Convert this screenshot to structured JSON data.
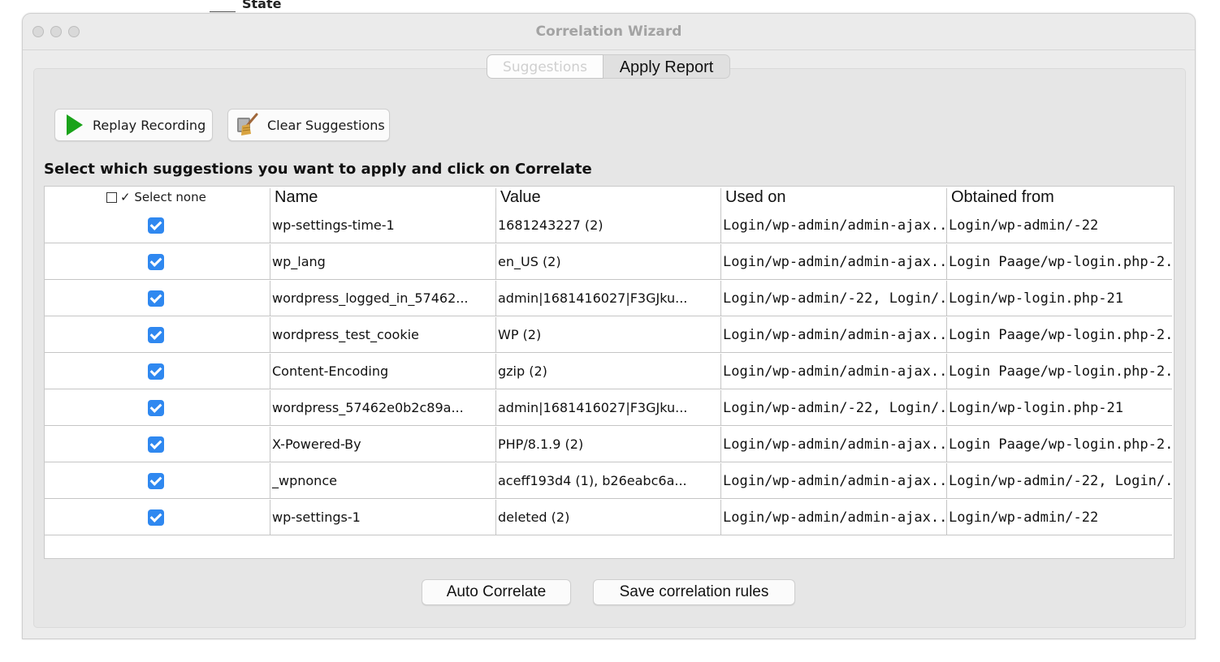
{
  "background": {
    "text": "State"
  },
  "window": {
    "title": "Correlation Wizard"
  },
  "tabs": [
    {
      "label": "Suggestions",
      "active": false
    },
    {
      "label": "Apply Report",
      "active": true
    }
  ],
  "toolbar": {
    "replay_label": "Replay Recording",
    "clear_label": "Clear Suggestions"
  },
  "instruction": "Select which suggestions you want to apply and click on Correlate",
  "table": {
    "select_none_label": "✓ Select none",
    "columns": [
      "Name",
      "Value",
      "Used on",
      "Obtained from"
    ],
    "rows": [
      {
        "checked": true,
        "name": "wp-settings-time-1",
        "value": "1681243227 (2)",
        "used_on": "Login/wp-admin/admin-ajax...",
        "obtained_from": "Login/wp-admin/-22"
      },
      {
        "checked": true,
        "name": "wp_lang",
        "value": "en_US (2)",
        "used_on": "Login/wp-admin/admin-ajax...",
        "obtained_from": "Login Paage/wp-login.php-2..."
      },
      {
        "checked": true,
        "name": "wordpress_logged_in_57462...",
        "value": "admin|1681416027|F3GJku...",
        "used_on": "Login/wp-admin/-22, Login/...",
        "obtained_from": "Login/wp-login.php-21"
      },
      {
        "checked": true,
        "name": "wordpress_test_cookie",
        "value": "WP (2)",
        "used_on": "Login/wp-admin/admin-ajax...",
        "obtained_from": "Login Paage/wp-login.php-2..."
      },
      {
        "checked": true,
        "name": "Content-Encoding",
        "value": "gzip (2)",
        "used_on": "Login/wp-admin/admin-ajax...",
        "obtained_from": "Login Paage/wp-login.php-2..."
      },
      {
        "checked": true,
        "name": "wordpress_57462e0b2c89a...",
        "value": "admin|1681416027|F3GJku...",
        "used_on": "Login/wp-admin/-22, Login/...",
        "obtained_from": "Login/wp-login.php-21"
      },
      {
        "checked": true,
        "name": "X-Powered-By",
        "value": "PHP/8.1.9 (2)",
        "used_on": "Login/wp-admin/admin-ajax...",
        "obtained_from": "Login Paage/wp-login.php-2..."
      },
      {
        "checked": true,
        "name": "_wpnonce",
        "value": "aceff193d4 (1), b26eabc6a...",
        "used_on": "Login/wp-admin/admin-ajax...",
        "obtained_from": "Login/wp-admin/-22, Login/..."
      },
      {
        "checked": true,
        "name": "wp-settings-1",
        "value": "deleted (2)",
        "used_on": "Login/wp-admin/admin-ajax...",
        "obtained_from": "Login/wp-admin/-22"
      }
    ]
  },
  "footer": {
    "auto_correlate_label": "Auto Correlate",
    "save_rules_label": "Save correlation rules"
  },
  "colors": {
    "accent": "#2f88f0",
    "play": "#1aa31a"
  }
}
